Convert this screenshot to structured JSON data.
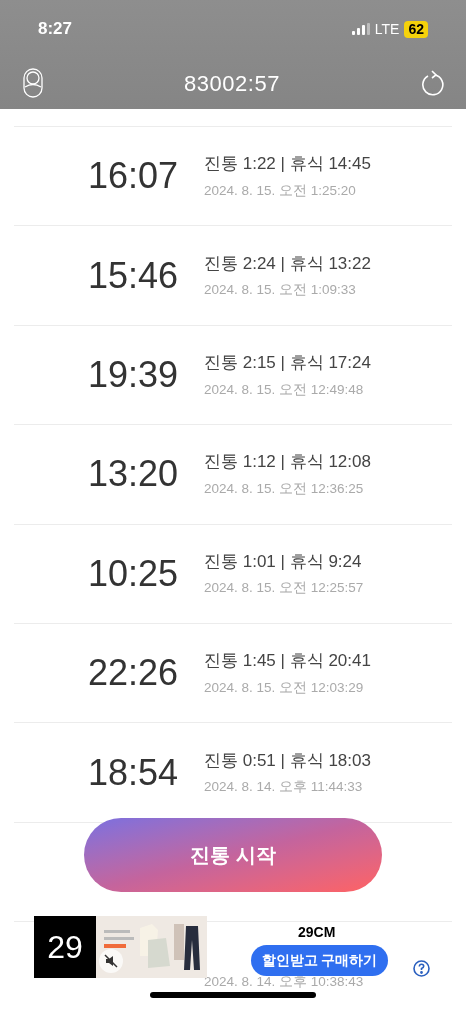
{
  "status_bar": {
    "time": "8:27",
    "network": "LTE",
    "battery": "62"
  },
  "header": {
    "title": "83002:57"
  },
  "records": [
    {
      "kind": "full",
      "interval": "16:07",
      "detail": "진통 1:22 | 휴식 14:45",
      "timestamp": "2024. 8. 15. 오전 1:25:20"
    },
    {
      "kind": "full",
      "interval": "15:46",
      "detail": "진통 2:24 | 휴식 13:22",
      "timestamp": "2024. 8. 15. 오전 1:09:33"
    },
    {
      "kind": "full",
      "interval": "19:39",
      "detail": "진통 2:15 | 휴식 17:24",
      "timestamp": "2024. 8. 15. 오전 12:49:48"
    },
    {
      "kind": "full",
      "interval": "13:20",
      "detail": "진통 1:12 | 휴식 12:08",
      "timestamp": "2024. 8. 15. 오전 12:36:25"
    },
    {
      "kind": "full",
      "interval": "10:25",
      "detail": "진통 1:01 | 휴식 9:24",
      "timestamp": "2024. 8. 15. 오전 12:25:57"
    },
    {
      "kind": "full",
      "interval": "22:26",
      "detail": "진통 1:45 | 휴식 20:41",
      "timestamp": "2024. 8. 15. 오전 12:03:29"
    },
    {
      "kind": "full",
      "interval": "18:54",
      "detail": "진통 0:51 | 휴식 18:03",
      "timestamp": "2024. 8. 14. 오후 11:44:33"
    },
    {
      "kind": "hidden"
    },
    {
      "kind": "date_only",
      "timestamp": "2024. 8. 14. 오후 10:38:43"
    }
  ],
  "start_button": {
    "label": "진통 시작"
  },
  "ad": {
    "logo": "29",
    "brand": "29CM",
    "cta": "할인받고 구매하기"
  }
}
